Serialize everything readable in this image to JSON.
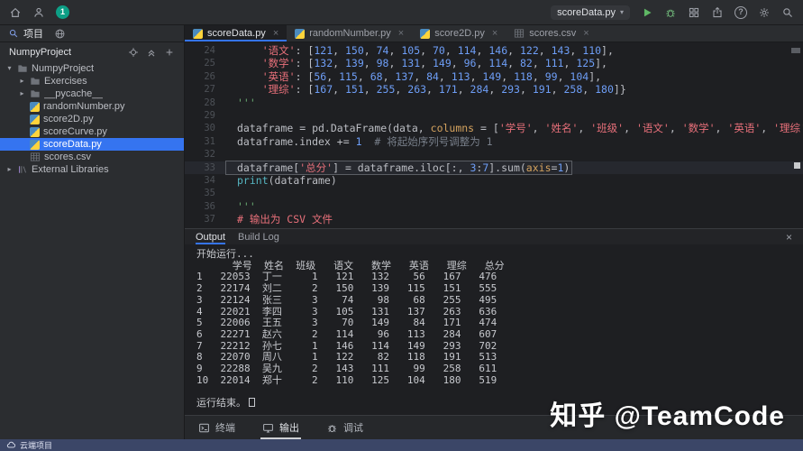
{
  "glyphs": {
    "close": "×",
    "caret": "▾",
    "open": "▾",
    "closed": "▸",
    "help": "?"
  },
  "titlebar": {
    "run_config": "scoreData.py",
    "notification_count": "1"
  },
  "tool_window_bar": {
    "project_tab": "项目"
  },
  "project_panel": {
    "header": "NumpyProject",
    "tree": [
      {
        "id": "numpyproject",
        "label": "NumpyProject",
        "icon": "folder",
        "chevron": "open",
        "indent": 0
      },
      {
        "id": "exercises",
        "label": "Exercises",
        "icon": "folder",
        "chevron": "closed",
        "indent": 1
      },
      {
        "id": "pycache",
        "label": "__pycache__",
        "icon": "folder",
        "chevron": "closed",
        "indent": 1
      },
      {
        "id": "randomnumber-py",
        "label": "randomNumber.py",
        "icon": "python",
        "indent": 1
      },
      {
        "id": "score2d-py",
        "label": "score2D.py",
        "icon": "python",
        "indent": 1
      },
      {
        "id": "scorecurve-py",
        "label": "scoreCurve.py",
        "icon": "python",
        "indent": 1
      },
      {
        "id": "scoredata-py",
        "label": "scoreData.py",
        "icon": "python",
        "indent": 1,
        "selected": true
      },
      {
        "id": "scores-csv",
        "label": "scores.csv",
        "icon": "csv",
        "indent": 1
      },
      {
        "id": "external-libraries",
        "label": "External Libraries",
        "icon": "library",
        "chevron": "closed",
        "indent": 0
      }
    ]
  },
  "editor": {
    "tabs": [
      {
        "id": "scoredata-py",
        "label": "scoreData.py",
        "icon": "python",
        "active": true
      },
      {
        "id": "randomnumber-py",
        "label": "randomNumber.py",
        "icon": "python"
      },
      {
        "id": "score2d-py",
        "label": "score2D.py",
        "icon": "python"
      },
      {
        "id": "scores-csv",
        "label": "scores.csv",
        "icon": "csv"
      }
    ],
    "code": [
      {
        "n": "24",
        "seg": [
          [
            "p",
            "    "
          ],
          [
            "s",
            "'语文'"
          ],
          [
            "p",
            ": ["
          ],
          [
            "n",
            "121"
          ],
          [
            "p",
            ", "
          ],
          [
            "n",
            "150"
          ],
          [
            "p",
            ", "
          ],
          [
            "n",
            "74"
          ],
          [
            "p",
            ", "
          ],
          [
            "n",
            "105"
          ],
          [
            "p",
            ", "
          ],
          [
            "n",
            "70"
          ],
          [
            "p",
            ", "
          ],
          [
            "n",
            "114"
          ],
          [
            "p",
            ", "
          ],
          [
            "n",
            "146"
          ],
          [
            "p",
            ", "
          ],
          [
            "n",
            "122"
          ],
          [
            "p",
            ", "
          ],
          [
            "n",
            "143"
          ],
          [
            "p",
            ", "
          ],
          [
            "n",
            "110"
          ],
          [
            "p",
            "],"
          ]
        ]
      },
      {
        "n": "25",
        "seg": [
          [
            "p",
            "    "
          ],
          [
            "s",
            "'数学'"
          ],
          [
            "p",
            ": ["
          ],
          [
            "n",
            "132"
          ],
          [
            "p",
            ", "
          ],
          [
            "n",
            "139"
          ],
          [
            "p",
            ", "
          ],
          [
            "n",
            "98"
          ],
          [
            "p",
            ", "
          ],
          [
            "n",
            "131"
          ],
          [
            "p",
            ", "
          ],
          [
            "n",
            "149"
          ],
          [
            "p",
            ", "
          ],
          [
            "n",
            "96"
          ],
          [
            "p",
            ", "
          ],
          [
            "n",
            "114"
          ],
          [
            "p",
            ", "
          ],
          [
            "n",
            "82"
          ],
          [
            "p",
            ", "
          ],
          [
            "n",
            "111"
          ],
          [
            "p",
            ", "
          ],
          [
            "n",
            "125"
          ],
          [
            "p",
            "],"
          ]
        ]
      },
      {
        "n": "26",
        "seg": [
          [
            "p",
            "    "
          ],
          [
            "s",
            "'英语'"
          ],
          [
            "p",
            ": ["
          ],
          [
            "n",
            "56"
          ],
          [
            "p",
            ", "
          ],
          [
            "n",
            "115"
          ],
          [
            "p",
            ", "
          ],
          [
            "n",
            "68"
          ],
          [
            "p",
            ", "
          ],
          [
            "n",
            "137"
          ],
          [
            "p",
            ", "
          ],
          [
            "n",
            "84"
          ],
          [
            "p",
            ", "
          ],
          [
            "n",
            "113"
          ],
          [
            "p",
            ", "
          ],
          [
            "n",
            "149"
          ],
          [
            "p",
            ", "
          ],
          [
            "n",
            "118"
          ],
          [
            "p",
            ", "
          ],
          [
            "n",
            "99"
          ],
          [
            "p",
            ", "
          ],
          [
            "n",
            "104"
          ],
          [
            "p",
            "],"
          ]
        ]
      },
      {
        "n": "27",
        "seg": [
          [
            "p",
            "    "
          ],
          [
            "s",
            "'理综'"
          ],
          [
            "p",
            ": ["
          ],
          [
            "n",
            "167"
          ],
          [
            "p",
            ", "
          ],
          [
            "n",
            "151"
          ],
          [
            "p",
            ", "
          ],
          [
            "n",
            "255"
          ],
          [
            "p",
            ", "
          ],
          [
            "n",
            "263"
          ],
          [
            "p",
            ", "
          ],
          [
            "n",
            "171"
          ],
          [
            "p",
            ", "
          ],
          [
            "n",
            "284"
          ],
          [
            "p",
            ", "
          ],
          [
            "n",
            "293"
          ],
          [
            "p",
            ", "
          ],
          [
            "n",
            "191"
          ],
          [
            "p",
            ", "
          ],
          [
            "n",
            "258"
          ],
          [
            "p",
            ", "
          ],
          [
            "n",
            "180"
          ],
          [
            "p",
            "]}"
          ]
        ]
      },
      {
        "n": "28",
        "seg": [
          [
            "g",
            "'''"
          ]
        ]
      },
      {
        "n": "29",
        "seg": []
      },
      {
        "n": "30",
        "seg": [
          [
            "p",
            "dataframe = pd.DataFrame(data, "
          ],
          [
            "k",
            "columns"
          ],
          [
            "p",
            " = ["
          ],
          [
            "s",
            "'学号'"
          ],
          [
            "p",
            ", "
          ],
          [
            "s",
            "'姓名'"
          ],
          [
            "p",
            ", "
          ],
          [
            "s",
            "'班级'"
          ],
          [
            "p",
            ", "
          ],
          [
            "s",
            "'语文'"
          ],
          [
            "p",
            ", "
          ],
          [
            "s",
            "'数学'"
          ],
          [
            "p",
            ", "
          ],
          [
            "s",
            "'英语'"
          ],
          [
            "p",
            ", "
          ],
          [
            "s",
            "'理综'"
          ],
          [
            "p",
            "])"
          ]
        ]
      },
      {
        "n": "31",
        "seg": [
          [
            "p",
            "dataframe.index += "
          ],
          [
            "n",
            "1"
          ],
          [
            "p",
            "  "
          ],
          [
            "c",
            "# 将起始序列号调整为 1"
          ]
        ]
      },
      {
        "n": "32",
        "seg": []
      },
      {
        "n": "33",
        "boxed": true,
        "seg": [
          [
            "p",
            "dataframe["
          ],
          [
            "s",
            "'总分'"
          ],
          [
            "p",
            "] = dataframe.iloc[:, "
          ],
          [
            "n",
            "3"
          ],
          [
            "p",
            ":"
          ],
          [
            "n",
            "7"
          ],
          [
            "p",
            "].sum("
          ],
          [
            "k",
            "axis"
          ],
          [
            "p",
            "="
          ],
          [
            "n",
            "1"
          ],
          [
            "p",
            ")"
          ]
        ]
      },
      {
        "n": "34",
        "seg": [
          [
            "b",
            "print"
          ],
          [
            "p",
            "(dataframe)"
          ]
        ]
      },
      {
        "n": "35",
        "seg": []
      },
      {
        "n": "36",
        "seg": [
          [
            "g",
            "'''"
          ]
        ]
      },
      {
        "n": "37",
        "seg": [
          [
            "s",
            "# 输出为 CSV 文件"
          ]
        ]
      }
    ]
  },
  "output": {
    "tabs": [
      {
        "id": "output",
        "label": "Output",
        "active": true
      },
      {
        "id": "build-log",
        "label": "Build Log"
      }
    ],
    "console": [
      "开始运行...",
      "      学号  姓名  班级   语文   数学   英语   理综   总分",
      "1   22053  丁一     1   121   132    56   167   476",
      "2   22174  刘二     2   150   139   115   151   555",
      "3   22124  张三     3    74    98    68   255   495",
      "4   22021  李四     3   105   131   137   263   636",
      "5   22006  王五     3    70   149    84   171   474",
      "6   22271  赵六     2   114    96   113   284   607",
      "7   22212  孙七     1   146   114   149   293   702",
      "8   22070  周八     1   122    82   118   191   513",
      "9   22288  吴九     2   143   111    99   258   611",
      "10  22014  郑十     2   110   125   104   180   519",
      "",
      "运行结束。"
    ]
  },
  "bottom_toolbar": {
    "items": [
      {
        "id": "terminal",
        "label": "终端",
        "icon": "terminal"
      },
      {
        "id": "output",
        "label": "输出",
        "icon": "output",
        "active": true
      },
      {
        "id": "debug",
        "label": "调试",
        "icon": "debug"
      }
    ]
  },
  "status_bar": {
    "project_label": "云端项目"
  },
  "watermark": {
    "text": "知乎 @TeamCode"
  },
  "colors": {
    "accent": "#3574f0",
    "selection": "#3574f0",
    "run_green": "#5fb865",
    "string": "#e8707a",
    "number": "#6e9ef7",
    "keyword_arg": "#d5a35f",
    "docstring": "#6aab73"
  }
}
